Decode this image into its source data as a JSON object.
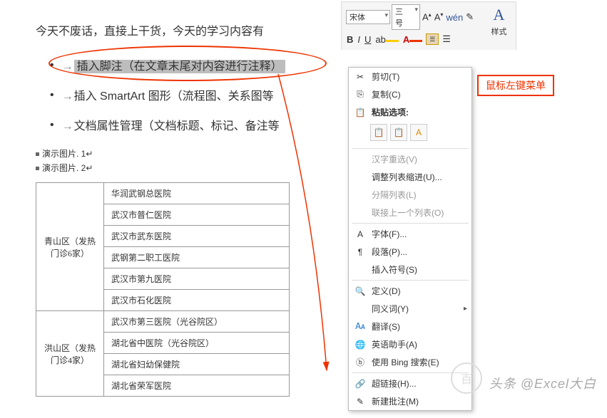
{
  "doc": {
    "intro": "今天不废话，直接上干货，今天的学习内容有",
    "bullets": [
      "插入脚注（在文章末尾对内容进行注释）",
      "插入 SmartArt 图形（流程图、关系图等",
      "文档属性管理（文档标题、标记、备注等"
    ],
    "demo1": "演示图片. 1",
    "demo2": "演示图片. 2",
    "tbl": {
      "g1": "青山区（发热门诊6家）",
      "g1r": [
        "华润武钢总医院",
        "武汉市普仁医院",
        "武汉市武东医院",
        "武钢第二职工医院",
        "武汉市第九医院",
        "武汉市石化医院"
      ],
      "g2": "洪山区（发热门诊4家）",
      "g2r": [
        "武汉市第三医院（光谷院区）",
        "湖北省中医院（光谷院区）",
        "湖北省妇幼保健院",
        "湖北省荣军医院"
      ]
    }
  },
  "toolbar": {
    "font": "宋体",
    "size": "三号",
    "stylesLabel": "样式"
  },
  "annotation": "鼠标左键菜单",
  "menu": {
    "cut": "剪切(T)",
    "copy": "复制(C)",
    "pasteOpt": "粘贴选项:",
    "hanzi": "汉字重选(V)",
    "adjustList": "调整列表缩进(U)...",
    "splitList": "分隔列表(L)",
    "linkPrev": "联接上一个列表(O)",
    "font": "字体(F)...",
    "para": "段落(P)...",
    "insertSym": "插入符号(S)",
    "define": "定义(D)",
    "synonym": "同义词(Y)",
    "translate": "翻译(S)",
    "english": "英语助手(A)",
    "bing": "使用 Bing 搜索(E)",
    "hyperlink": "超链接(H)...",
    "newComment": "新建批注(M)"
  },
  "watermark": "头条 @Excel大白",
  "wm2": "百"
}
